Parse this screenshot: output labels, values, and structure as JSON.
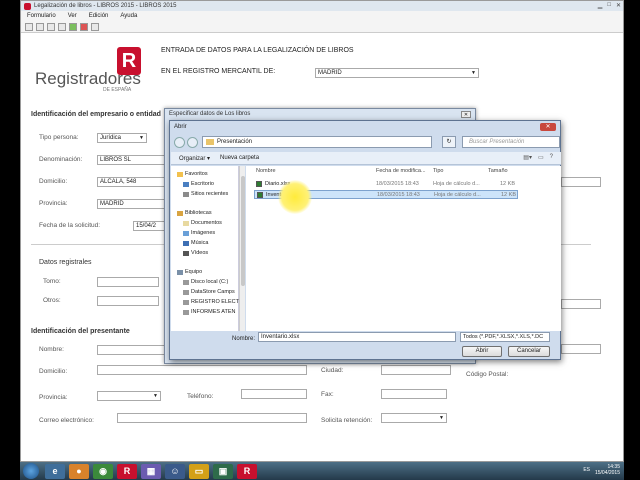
{
  "window": {
    "title": "Legalización de libros - LIBROS 2015 - LIBROS 2015"
  },
  "menu": [
    "Formulario",
    "Ver",
    "Edición",
    "Ayuda"
  ],
  "brand": {
    "name": "Registradores",
    "sub": "DE ESPAÑA",
    "mark": "R",
    "color": "#c8102e"
  },
  "header": {
    "line1": "ENTRADA DE DATOS PARA LA LEGALIZACIÓN DE LIBROS",
    "line2": "EN EL REGISTRO MERCANTIL DE:",
    "registry": "MADRID"
  },
  "section_empresario": {
    "title": "Identificación del empresario o entidad",
    "tipo_persona_label": "Tipo persona:",
    "tipo_persona": "Jurídica",
    "denominacion_label": "Denominación:",
    "denominacion": "LIBROS SL",
    "domicilio_label": "Domicilio:",
    "domicilio": "ALCALA, 548",
    "provincia_label": "Provincia:",
    "provincia": "MADRID",
    "fecha_label": "Fecha de la solicitud:",
    "fecha": "15/04/2"
  },
  "section_registrales": {
    "title": "Datos registrales",
    "tomo_label": "Tomo:",
    "otros_label": "Otros:"
  },
  "section_presentante": {
    "title": "Identificación del presentante",
    "nombre_label": "Nombre:",
    "domicilio_label": "Domicilio:",
    "provincia_label": "Provincia:",
    "telefono_label": "Teléfono:",
    "fax_label": "Fax:",
    "ciudad_label": "Ciudad:",
    "codigo_postal_label": "Código Postal:",
    "correo_label": "Correo electrónico:",
    "solicita_label": "Solicita retención:"
  },
  "bg_dialog": {
    "title": "Especificar datos de Los libros"
  },
  "open_dialog": {
    "title": "Abrir",
    "path": "Presentación",
    "search_placeholder": "Buscar Presentación",
    "organize": "Organizar ▾",
    "new_folder": "Nueva carpeta",
    "nav": {
      "favorites": "Favoritos",
      "escritorio": "Escritorio",
      "sitios": "Sitios recientes",
      "bibliotecas": "Bibliotecas",
      "documentos": "Documentos",
      "imagenes": "Imágenes",
      "musica": "Música",
      "videos": "Vídeos",
      "equipo": "Equipo",
      "disco": "Disco local (C:)",
      "datastore": "DataStore Camps",
      "registro": "REGISTRO ELECT",
      "informes": "INFORMES ATEN"
    },
    "columns": {
      "name": "Nombre",
      "date": "Fecha de modifica...",
      "type": "Tipo",
      "size": "Tamaño"
    },
    "files": [
      {
        "name": "Diario.xlsx",
        "date": "18/03/2015 18:43",
        "type": "Hoja de cálculo d...",
        "size": "12 KB"
      },
      {
        "name": "Inventario.xlsx",
        "date": "18/03/2015 18:43",
        "type": "Hoja de cálculo d...",
        "size": "12 KB"
      }
    ],
    "filename_label": "Nombre:",
    "filename": "Inventario.xlsx",
    "filetype": "Todos (*.PDF,*.XLSX,*.XLS,*.DC",
    "open_btn": "Abrir",
    "cancel_btn": "Cancelar"
  },
  "taskbar": {
    "lang": "ES",
    "time": "14:35",
    "date": "15/04/2015"
  }
}
